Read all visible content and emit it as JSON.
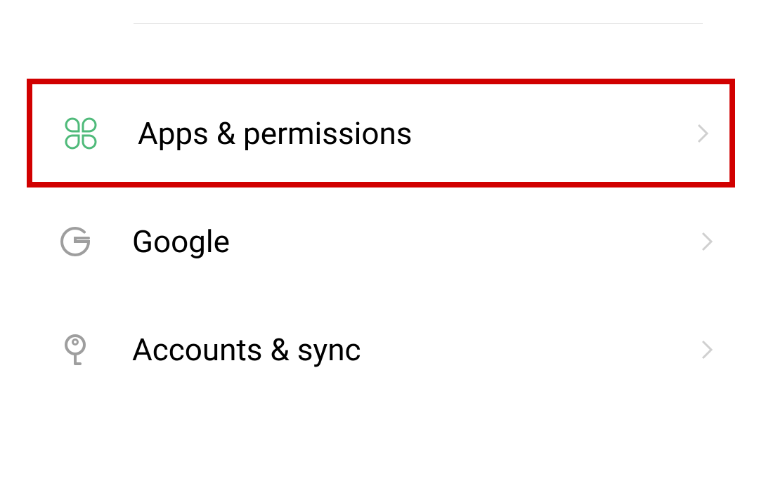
{
  "settings": {
    "items": [
      {
        "label": "Apps & permissions",
        "icon": "apps",
        "highlighted": true
      },
      {
        "label": "Google",
        "icon": "google",
        "highlighted": false
      },
      {
        "label": "Accounts & sync",
        "icon": "key",
        "highlighted": false
      }
    ]
  }
}
